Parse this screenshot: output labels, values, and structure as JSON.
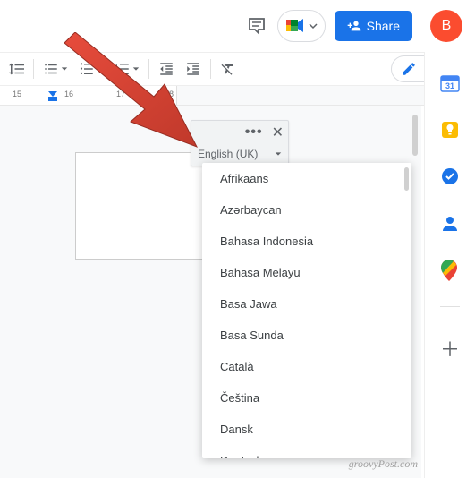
{
  "topbar": {
    "share_label": "Share",
    "avatar_letter": "B"
  },
  "ruler": {
    "ticks": [
      "15",
      "16",
      "17",
      "18"
    ]
  },
  "language_panel": {
    "selected": "English (UK)"
  },
  "language_menu": {
    "items": [
      "Afrikaans",
      "Azərbaycan",
      "Bahasa Indonesia",
      "Bahasa Melayu",
      "Basa Jawa",
      "Basa Sunda",
      "Català",
      "Čeština",
      "Dansk",
      "Deutsch"
    ]
  },
  "watermark": "groovyPost.com"
}
